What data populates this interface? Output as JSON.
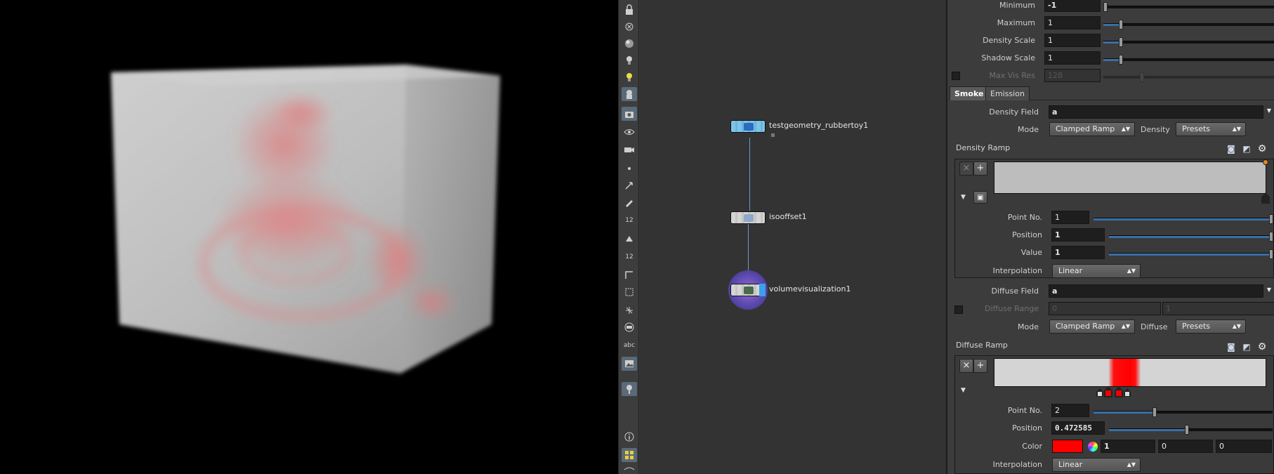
{
  "network": {
    "nodes": [
      {
        "name": "testgeometry_rubbertoy1"
      },
      {
        "name": "isooffset1"
      },
      {
        "name": "volumevisualization1"
      }
    ]
  },
  "shelf": {
    "text_tools": {
      "twelve_a": "12",
      "twelve_b": "12",
      "abc": "abc"
    }
  },
  "params": {
    "minimum": {
      "label": "Minimum",
      "value": "-1"
    },
    "maximum": {
      "label": "Maximum",
      "value": "1"
    },
    "density_scale": {
      "label": "Density Scale",
      "value": "1"
    },
    "shadow_scale": {
      "label": "Shadow Scale",
      "value": "1"
    },
    "max_vis_res": {
      "label": "Max Vis Res",
      "value": "128"
    },
    "tabs": [
      "Smoke",
      "Emission"
    ],
    "density_field": {
      "label": "Density Field",
      "value": "a"
    },
    "density_mode": {
      "label": "Mode",
      "value": "Clamped Ramp",
      "side_label": "Density",
      "presets": "Presets"
    },
    "density_ramp": {
      "title": "Density Ramp",
      "point_no": {
        "label": "Point No.",
        "value": "1"
      },
      "position": {
        "label": "Position",
        "value": "1"
      },
      "value": {
        "label": "Value",
        "value": "1"
      },
      "interpolation": {
        "label": "Interpolation",
        "value": "Linear"
      }
    },
    "diffuse_field": {
      "label": "Diffuse Field",
      "value": "a"
    },
    "diffuse_range": {
      "label": "Diffuse Range",
      "min": "0",
      "max": "1"
    },
    "diffuse_mode": {
      "label": "Mode",
      "value": "Clamped Ramp",
      "side_label": "Diffuse",
      "presets": "Presets"
    },
    "diffuse_ramp": {
      "title": "Diffuse Ramp",
      "point_no": {
        "label": "Point No.",
        "value": "2"
      },
      "position": {
        "label": "Position",
        "value": "0.472585"
      },
      "color": {
        "label": "Color",
        "r": "1",
        "g": "0",
        "b": "0",
        "swatch": "#ff0000"
      },
      "interpolation": {
        "label": "Interpolation",
        "value": "Linear"
      }
    }
  }
}
